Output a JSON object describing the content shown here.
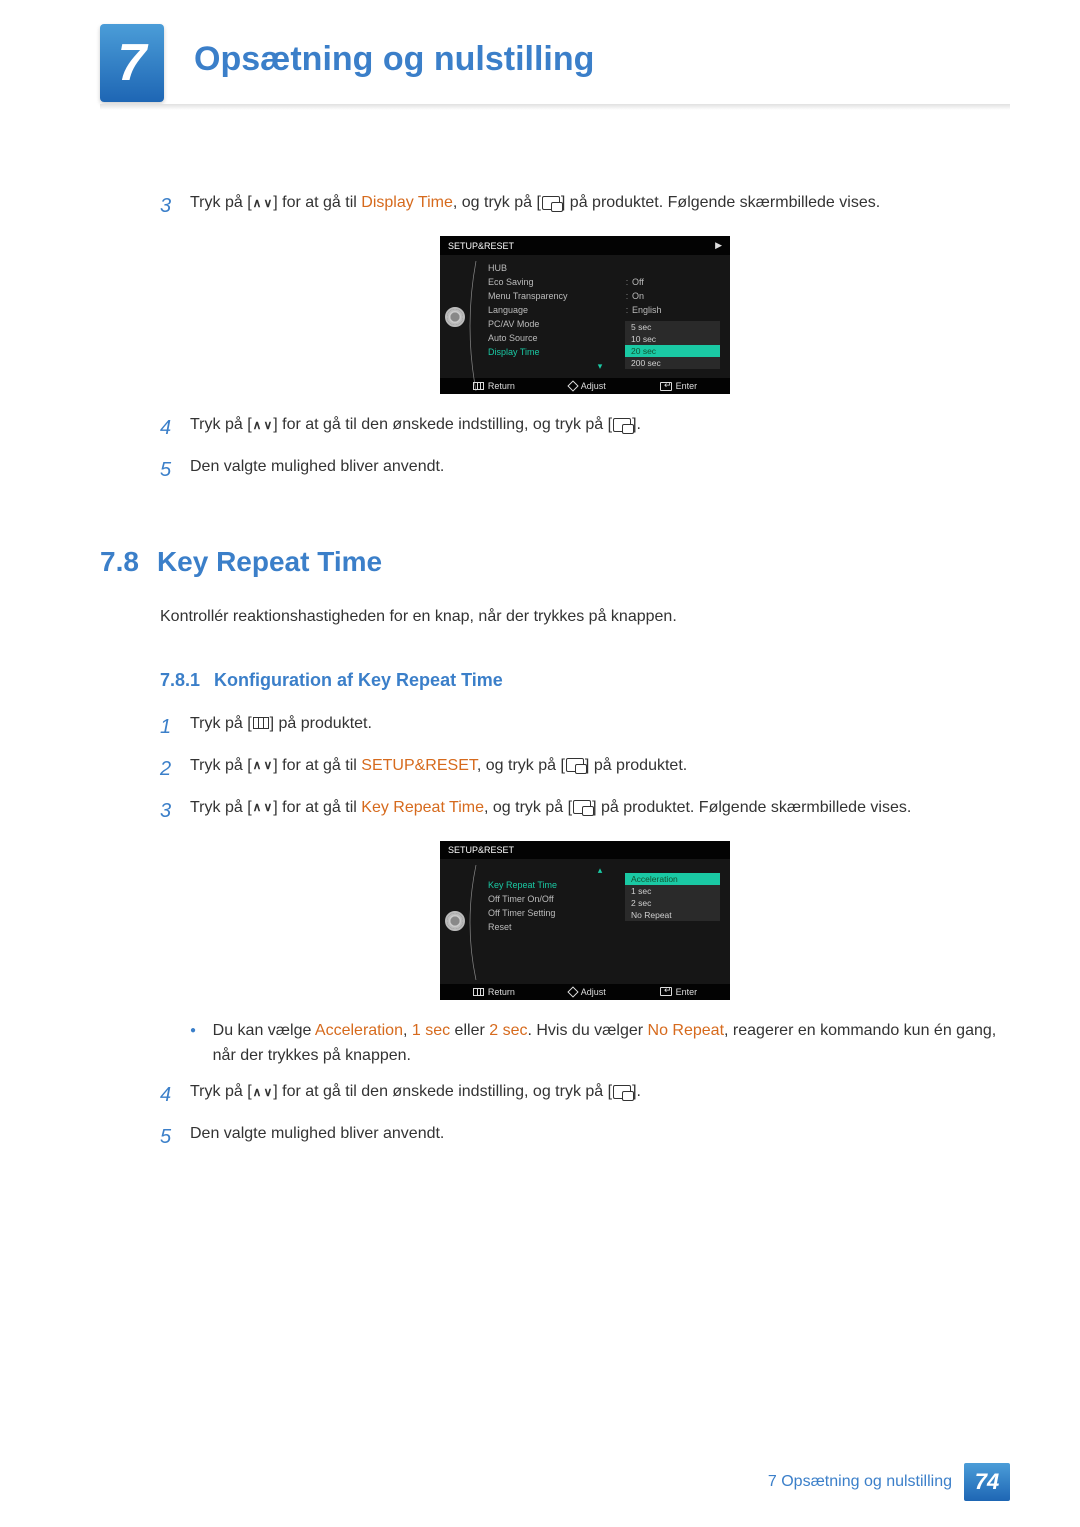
{
  "chapter": {
    "num": "7",
    "title": "Opsætning og nulstilling"
  },
  "step3": {
    "num": "3",
    "before": "Tryk på [",
    "mid1": "] for at gå til ",
    "target": "Display Time",
    "mid2": ", og tryk på [",
    "after": "] på produktet. Følgende skærmbillede vises."
  },
  "osd1": {
    "title": "SETUP&RESET",
    "rows": [
      {
        "label": "HUB",
        "val": ""
      },
      {
        "label": "Eco Saving",
        "val": "Off"
      },
      {
        "label": "Menu Transparency",
        "val": "On"
      },
      {
        "label": "Language",
        "val": "English"
      },
      {
        "label": "PC/AV Mode",
        "val": ""
      },
      {
        "label": "Auto Source",
        "val": ""
      },
      {
        "label": "Display Time",
        "val": ""
      }
    ],
    "dropdown": [
      "5 sec",
      "10 sec",
      "20 sec",
      "200 sec"
    ],
    "selected": "20 sec",
    "footer": {
      "return": "Return",
      "adjust": "Adjust",
      "enter": "Enter"
    }
  },
  "step4": {
    "num": "4",
    "before": "Tryk på [",
    "mid": "] for at gå til den ønskede indstilling, og tryk på [",
    "after": "]."
  },
  "step5": {
    "num": "5",
    "text": "Den valgte mulighed bliver anvendt."
  },
  "section78": {
    "num": "7.8",
    "title": "Key Repeat Time"
  },
  "intro78": "Kontrollér reaktionshastigheden for en knap, når der trykkes på knappen.",
  "sub781": {
    "num": "7.8.1",
    "title": "Konfiguration af Key Repeat Time"
  },
  "s781_1": {
    "num": "1",
    "before": "Tryk på [",
    "after": "] på produktet."
  },
  "s781_2": {
    "num": "2",
    "before": "Tryk på [",
    "mid1": "] for at gå til ",
    "target": "SETUP&RESET",
    "mid2": ", og tryk på [",
    "after": "] på produktet."
  },
  "s781_3": {
    "num": "3",
    "before": "Tryk på [",
    "mid1": "] for at gå til ",
    "target": "Key Repeat Time",
    "mid2": ", og tryk på [",
    "after": "] på produktet. Følgende skærmbillede vises."
  },
  "osd2": {
    "title": "SETUP&RESET",
    "rows": [
      {
        "label": "Key Repeat Time",
        "val": ""
      },
      {
        "label": "Off Timer On/Off",
        "val": ""
      },
      {
        "label": "Off Timer Setting",
        "val": ""
      },
      {
        "label": "Reset",
        "val": ""
      }
    ],
    "dropdown": [
      "Acceleration",
      "1 sec",
      "2 sec",
      "No Repeat"
    ],
    "selected": "Acceleration",
    "footer": {
      "return": "Return",
      "adjust": "Adjust",
      "enter": "Enter"
    }
  },
  "bullet1": {
    "before": "Du kan vælge ",
    "w1": "Acceleration",
    "c1": ", ",
    "w2": "1 sec",
    "c2": " eller ",
    "w3": "2 sec",
    "mid": ". Hvis du vælger ",
    "w4": "No Repeat",
    "after": ", reagerer en kommando kun én gang, når der trykkes på knappen."
  },
  "s781_4": {
    "num": "4",
    "before": "Tryk på [",
    "mid": "] for at gå til den ønskede indstilling, og tryk på [",
    "after": "]."
  },
  "s781_5": {
    "num": "5",
    "text": "Den valgte mulighed bliver anvendt."
  },
  "footer": {
    "title": "7 Opsætning og nulstilling",
    "page": "74"
  }
}
